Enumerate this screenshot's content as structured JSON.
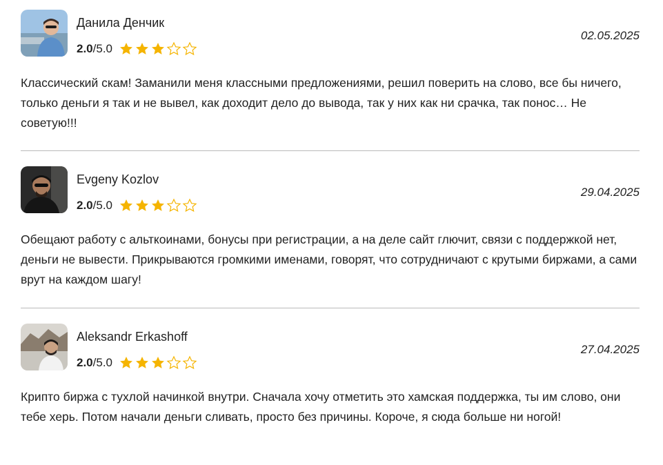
{
  "reviews": [
    {
      "author": "Данила Денчик",
      "score": "2.0",
      "max": "/5.0",
      "stars": {
        "filled": 3,
        "total": 5
      },
      "date": "02.05.2025",
      "text": "Классический скам! Заманили меня классными предложениями, решил поверить на слово, все бы ничего, только деньги я так и не вывел, как доходит дело до вывода, так у них как ни срачка, так понос… Не советую!!!"
    },
    {
      "author": "Evgeny Kozlov",
      "score": "2.0",
      "max": "/5.0",
      "stars": {
        "filled": 3,
        "total": 5
      },
      "date": "29.04.2025",
      "text": "Обещают работу с альткоинами, бонусы при регистрации, а на деле сайт глючит, связи с поддержкой нет, деньги не вывести. Прикрываются громкими именами, говорят, что сотрудничают с крутыми биржами, а сами врут на каждом шагу!"
    },
    {
      "author": "Aleksandr Erkashoff",
      "score": "2.0",
      "max": "/5.0",
      "stars": {
        "filled": 3,
        "total": 5
      },
      "date": "27.04.2025",
      "text": "Крипто биржа с тухлой начинкой внутри. Сначала хочу отметить это хамская поддержка, ты им слово, они тебе херь. Потом начали деньги сливать, просто без причины. Короче, я сюда больше ни ногой!"
    }
  ],
  "colors": {
    "star_fill": "#f5b400",
    "star_empty_stroke": "#f5b400",
    "text": "#222222",
    "divider": "#b9b9b9"
  },
  "icons": {
    "star_filled": "star-filled-icon",
    "star_empty": "star-empty-icon"
  }
}
